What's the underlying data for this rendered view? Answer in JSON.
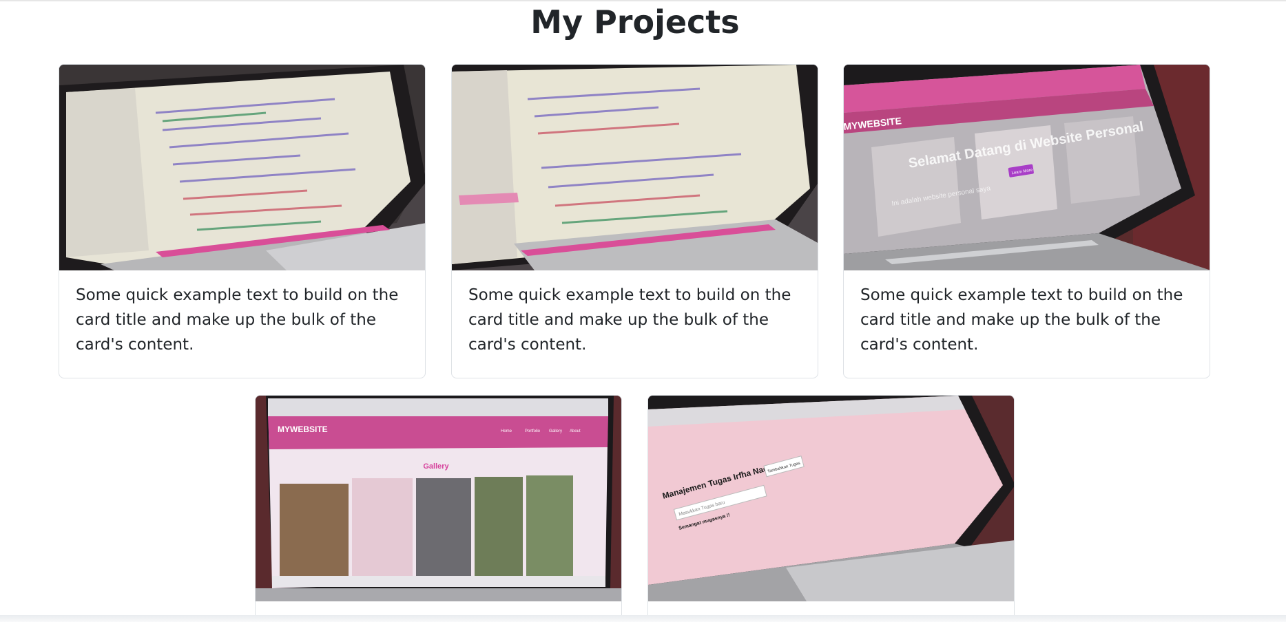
{
  "page": {
    "title": "My Projects"
  },
  "cards": [
    {
      "text": "Some quick example text to build on the card title and make up the bulk of the card's content.",
      "image_alt": "laptop showing code editor"
    },
    {
      "text": "Some quick example text to build on the card title and make up the bulk of the card's content.",
      "image_alt": "laptop showing code editor"
    },
    {
      "text": "Some quick example text to build on the card title and make up the bulk of the card's content.",
      "image_alt": "laptop showing MYWEBSITE homepage"
    },
    {
      "text": "",
      "image_alt": "laptop showing MYWEBSITE gallery"
    },
    {
      "text": "",
      "image_alt": "laptop showing task manager page"
    }
  ],
  "screens": {
    "brand": "MYWEBSITE",
    "hero_heading": "Selamat Datang di Website Personal",
    "hero_sub": "Ini adalah website personal saya",
    "hero_button": "Learn More",
    "nav": [
      "Home",
      "Portfolio",
      "Gallery",
      "About"
    ],
    "gallery_heading": "Gallery",
    "task_title": "Manajemen Tugas Irfha Naqis :>",
    "task_placeholder": "Masukkan Tugas baru",
    "task_button": "Tambahkan Tugas",
    "task_message": "Semangat mugasnya !!"
  },
  "colors": {
    "accent_pink": "#d63384",
    "screen_pink_light": "#f4c6d8",
    "border": "#dee2e6",
    "text": "#212529"
  }
}
